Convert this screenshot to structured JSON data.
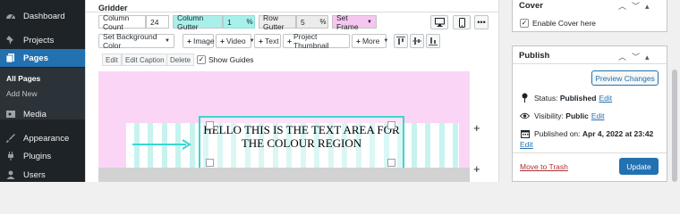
{
  "sidebar": {
    "items": [
      {
        "label": "Dashboard",
        "icon": "dashboard-icon"
      },
      {
        "label": "Projects",
        "icon": "pin-icon"
      },
      {
        "label": "Pages",
        "icon": "pages-icon"
      },
      {
        "label": "Media",
        "icon": "media-icon"
      },
      {
        "label": "Appearance",
        "icon": "brush-icon"
      },
      {
        "label": "Plugins",
        "icon": "plug-icon"
      },
      {
        "label": "Users",
        "icon": "user-icon"
      }
    ],
    "sub_items": [
      "All Pages",
      "Add New"
    ]
  },
  "gridder": {
    "title": "Gridder",
    "column_count_label": "Column Count",
    "column_count_value": "24",
    "column_gutter_label": "Column Gutter",
    "column_gutter_value": "1",
    "row_gutter_label": "Row Gutter",
    "row_gutter_value": "5",
    "percent": "%",
    "set_frame_label": "Set Frame",
    "set_bg_color_label": "Set Background Color",
    "add_image_label": "Image",
    "add_video_label": "Video",
    "add_text_label": "Text",
    "add_project_thumbnail_label": "Project Thumbnail",
    "add_more_label": "More",
    "edit_label": "Edit",
    "edit_caption_label": "Edit Caption",
    "delete_label": "Delete",
    "show_guides_label": "Show Guides",
    "text_block": "HELLO THIS IS THE TEXT AREA FOR THE COLOUR REGION"
  },
  "cover_box": {
    "title": "Cover",
    "enable_label": "Enable Cover here"
  },
  "publish_box": {
    "title": "Publish",
    "preview_label": "Preview Changes",
    "status_label": "Status:",
    "status_value": "Published",
    "visibility_label": "Visibility:",
    "visibility_value": "Public",
    "published_on_label": "Published on:",
    "published_on_value": "Apr 4, 2022 at 23:42",
    "edit_link": "Edit",
    "trash_label": "Move to Trash",
    "update_label": "Update"
  },
  "colors": {
    "accent": "#2271b1",
    "frame_pink": "#fbd5f6",
    "guide_cyan": "#c7f3ef",
    "selection_cyan": "#3ad6d1"
  }
}
